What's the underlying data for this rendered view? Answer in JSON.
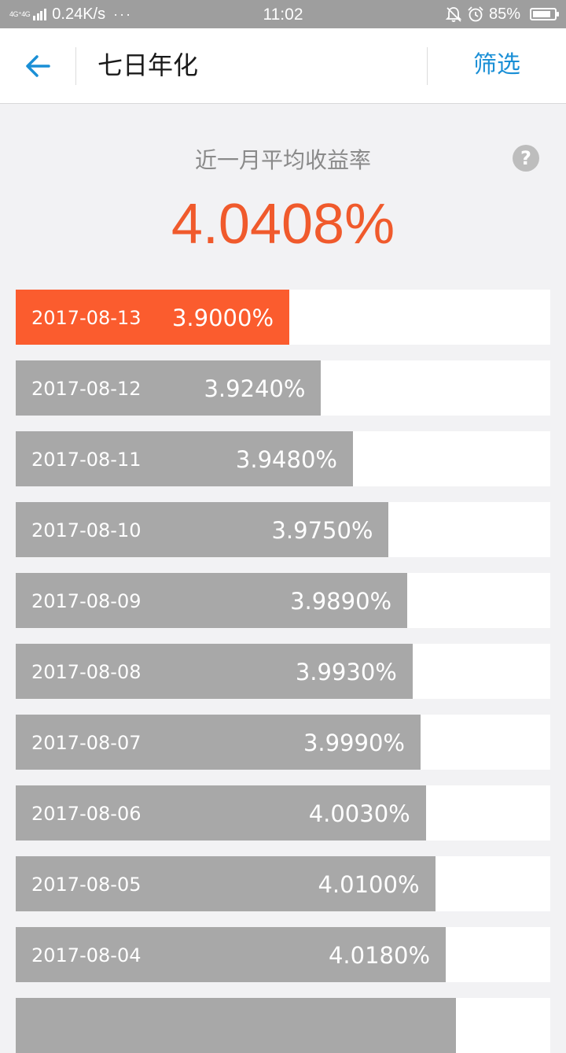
{
  "status_bar": {
    "network": "4G⁺4G",
    "speed": "0.24K/s",
    "more": "···",
    "time": "11:02",
    "battery": "85%",
    "battery_level": 0.85,
    "icons": [
      "mute-bell-icon",
      "alarm-clock-icon",
      "battery-icon"
    ]
  },
  "header": {
    "back_icon": "arrow-left-icon",
    "title": "七日年化",
    "filter_label": "筛选"
  },
  "summary": {
    "label": "近一月平均收益率",
    "help": "?",
    "value": "4.0408%"
  },
  "colors": {
    "accent": "#f05a2c",
    "selected_bar": "#fb5c2e",
    "bar": "#a8a8a8",
    "link": "#1a8fd6"
  },
  "rates": [
    {
      "date": "2017-08-13",
      "value": "3.9000%",
      "rate": 3.9,
      "selected": true
    },
    {
      "date": "2017-08-12",
      "value": "3.9240%",
      "rate": 3.924,
      "selected": false
    },
    {
      "date": "2017-08-11",
      "value": "3.9480%",
      "rate": 3.948,
      "selected": false
    },
    {
      "date": "2017-08-10",
      "value": "3.9750%",
      "rate": 3.975,
      "selected": false
    },
    {
      "date": "2017-08-09",
      "value": "3.9890%",
      "rate": 3.989,
      "selected": false
    },
    {
      "date": "2017-08-08",
      "value": "3.9930%",
      "rate": 3.993,
      "selected": false
    },
    {
      "date": "2017-08-07",
      "value": "3.9990%",
      "rate": 3.999,
      "selected": false
    },
    {
      "date": "2017-08-06",
      "value": "4.0030%",
      "rate": 4.003,
      "selected": false
    },
    {
      "date": "2017-08-05",
      "value": "4.0100%",
      "rate": 4.01,
      "selected": false
    },
    {
      "date": "2017-08-04",
      "value": "4.0180%",
      "rate": 4.018,
      "selected": false
    }
  ]
}
